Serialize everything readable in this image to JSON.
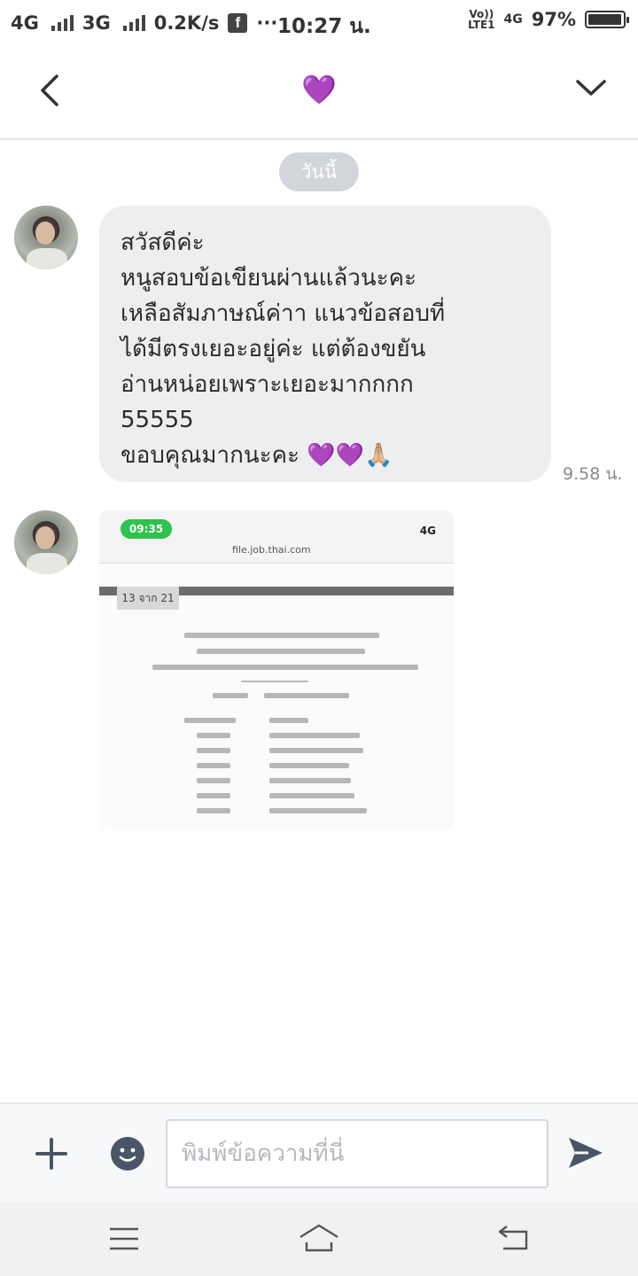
{
  "status_bar": {
    "network1": "4G",
    "network2": "3G",
    "speed": "0.2K/s",
    "more": "···",
    "time": "10:27 น.",
    "volte_top": "Vo))",
    "volte_bottom": "LTE1",
    "network3": "4G",
    "battery": "97%",
    "battery_level": 0.97
  },
  "header": {
    "title": "💜"
  },
  "chat": {
    "date_label": "วันนี้",
    "message": {
      "lines": [
        "สวัสดีค่ะ",
        "หนูสอบข้อเขียนผ่านแล้วนะคะ",
        "เหลือสัมภาษณ์ค่าา แนวข้อสอบที่",
        "ได้มีตรงเยอะอยู่ค่ะ แต่ต้องขยัน",
        "อ่านหน่อยเพราะเยอะมากกกก",
        "55555",
        "ขอบคุณมากนะคะ 💜💜🙏🏼"
      ],
      "time": "9.58 น."
    },
    "image_message": {
      "clock": "09:35",
      "status": "4G",
      "url": "file.job.thai.com",
      "page_label": "13 จาก 21"
    }
  },
  "input_bar": {
    "placeholder": "พิมพ์ข้อความที่นี่"
  },
  "colors": {
    "accent": "#4a5568",
    "bubble": "#edeef0",
    "pill": "#d2d5da",
    "heart": "#8a3ffc"
  }
}
